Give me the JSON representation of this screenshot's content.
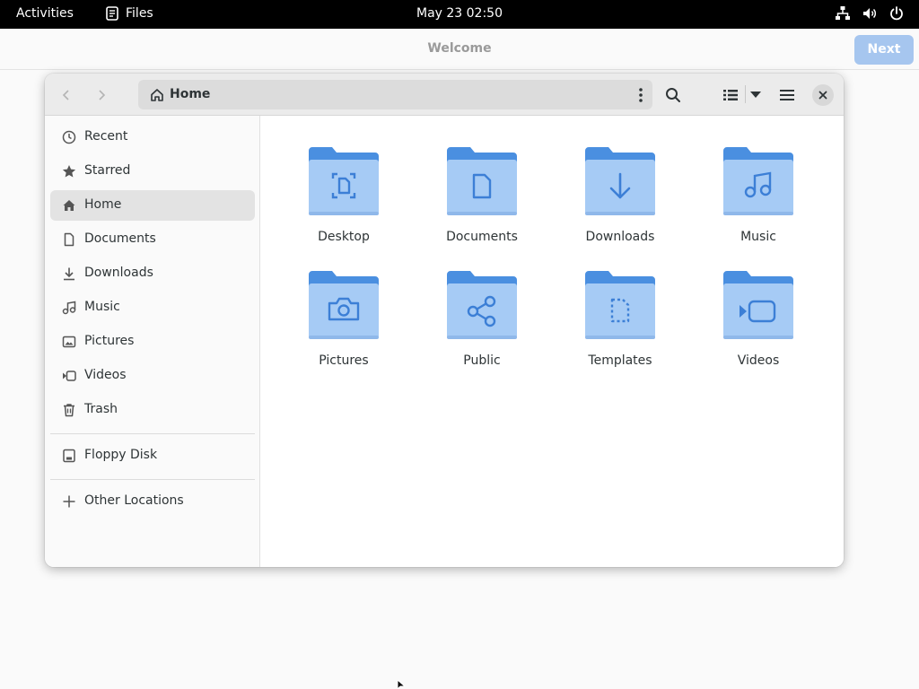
{
  "topbar": {
    "activities": "Activities",
    "app_name": "Files",
    "clock": "May 23  02:50"
  },
  "welcome": {
    "title": "Welcome",
    "next_label": "Next"
  },
  "pathbar": {
    "label": "Home"
  },
  "sidebar": {
    "items": [
      {
        "label": "Recent",
        "icon": "clock-icon"
      },
      {
        "label": "Starred",
        "icon": "star-icon"
      },
      {
        "label": "Home",
        "icon": "home-icon"
      },
      {
        "label": "Documents",
        "icon": "document-icon"
      },
      {
        "label": "Downloads",
        "icon": "download-icon"
      },
      {
        "label": "Music",
        "icon": "music-icon"
      },
      {
        "label": "Pictures",
        "icon": "picture-icon"
      },
      {
        "label": "Videos",
        "icon": "video-icon"
      },
      {
        "label": "Trash",
        "icon": "trash-icon"
      },
      {
        "label": "Floppy Disk",
        "icon": "drive-icon"
      },
      {
        "label": "Other Locations",
        "icon": "plus-icon"
      }
    ],
    "active": "Home"
  },
  "folders": [
    {
      "label": "Desktop",
      "icon": "desktop-folder-icon"
    },
    {
      "label": "Documents",
      "icon": "documents-folder-icon"
    },
    {
      "label": "Downloads",
      "icon": "downloads-folder-icon"
    },
    {
      "label": "Music",
      "icon": "music-folder-icon"
    },
    {
      "label": "Pictures",
      "icon": "pictures-folder-icon"
    },
    {
      "label": "Public",
      "icon": "public-folder-icon"
    },
    {
      "label": "Templates",
      "icon": "templates-folder-icon"
    },
    {
      "label": "Videos",
      "icon": "videos-folder-icon"
    }
  ],
  "colors": {
    "accent_button": "#a6c6ef",
    "folder_back": "#4a8fe0",
    "folder_front": "#a6cbf5",
    "folder_glyph": "#3c7fd6",
    "topbar": "#000000"
  }
}
